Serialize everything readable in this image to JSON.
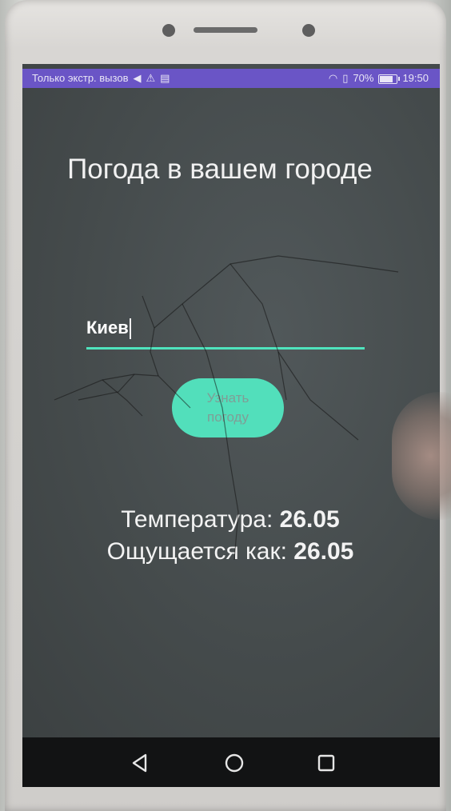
{
  "status_bar": {
    "carrier_text": "Только экстр. вызов",
    "battery_percent": "70%",
    "time": "19:50",
    "icons": [
      "send-icon",
      "warning-icon",
      "message-icon",
      "wifi-icon",
      "sim-icon",
      "battery-icon"
    ],
    "background_color": "#6a55c6"
  },
  "app": {
    "title": "Погода в вашем городе",
    "city_input_value": "Киев",
    "accent_color": "#4fe3bd",
    "button_label": "Узнать\nпогоду",
    "temperature_label": "Температура:",
    "temperature_value": "26.05",
    "feels_like_label": "Ощущается как:",
    "feels_like_value": "26.05"
  },
  "nav_bar": {
    "icons": [
      "back-icon",
      "home-icon",
      "recent-apps-icon"
    ]
  }
}
